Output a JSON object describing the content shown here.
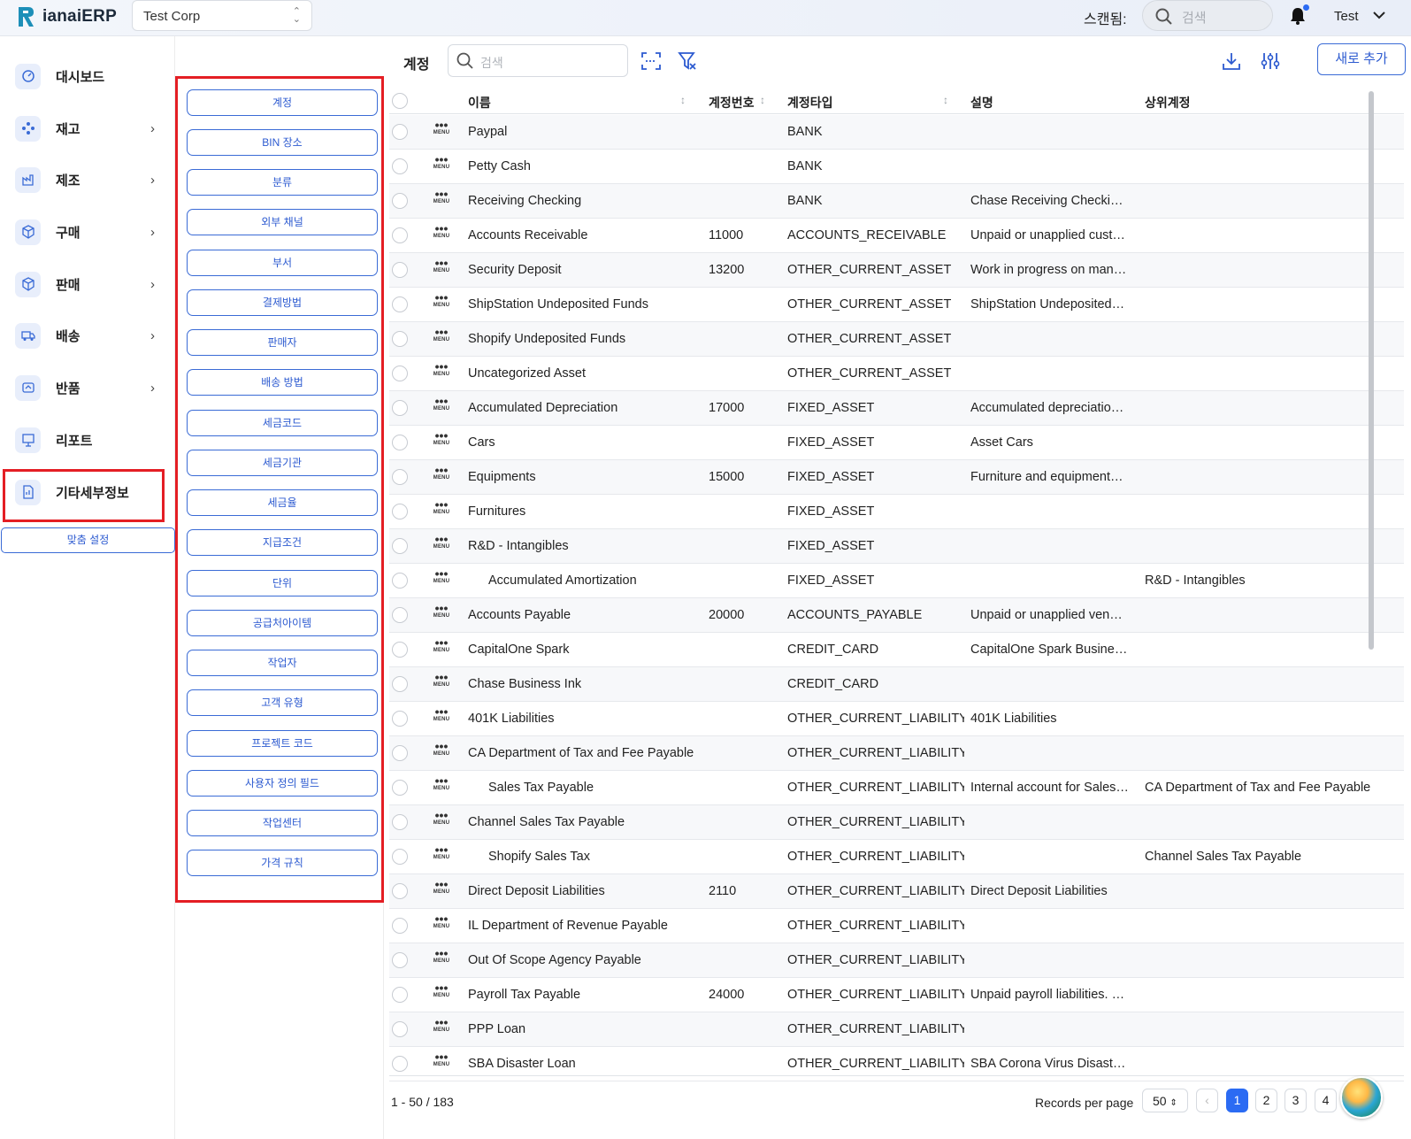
{
  "app": {
    "name": "ianaiERP",
    "company": "Test Corp",
    "scan_label": "스캔됨:",
    "search_placeholder": "검색",
    "user": "Test"
  },
  "sidebar": {
    "items": [
      {
        "label": "대시보드",
        "icon": "dashboard-icon",
        "chevron": false
      },
      {
        "label": "재고",
        "icon": "inventory-icon",
        "chevron": true
      },
      {
        "label": "제조",
        "icon": "manufacturing-icon",
        "chevron": true
      },
      {
        "label": "구매",
        "icon": "purchase-icon",
        "chevron": true
      },
      {
        "label": "판매",
        "icon": "sales-icon",
        "chevron": true
      },
      {
        "label": "배송",
        "icon": "shipping-icon",
        "chevron": true
      },
      {
        "label": "반품",
        "icon": "returns-icon",
        "chevron": true
      },
      {
        "label": "리포트",
        "icon": "report-icon",
        "chevron": false
      },
      {
        "label": "기타세부정보",
        "icon": "details-icon",
        "chevron": false
      }
    ],
    "custom_settings": "맞춤 설정"
  },
  "submenu": {
    "items": [
      "계정",
      "BIN 장소",
      "분류",
      "외부 채널",
      "부서",
      "결제방법",
      "판매자",
      "배송 방법",
      "세금코드",
      "세금기관",
      "세금율",
      "지급조건",
      "단위",
      "공급처아이템",
      "작업자",
      "고객 유형",
      "프로젝트 코드",
      "사용자 정의 필드",
      "작업센터",
      "가격 규칙"
    ]
  },
  "main": {
    "title": "계정",
    "search_placeholder": "검색",
    "add_button": "새로 추가",
    "columns": {
      "name": "이름",
      "number": "계정번호",
      "type": "계정타입",
      "description": "설명",
      "parent": "상위계정"
    },
    "menu_label": "MENU",
    "rows": [
      {
        "name": "Paypal",
        "number": "",
        "type": "BANK",
        "description": "",
        "parent": "",
        "indent": false
      },
      {
        "name": "Petty Cash",
        "number": "",
        "type": "BANK",
        "description": "",
        "parent": "",
        "indent": false
      },
      {
        "name": "Receiving Checking",
        "number": "",
        "type": "BANK",
        "description": "Chase Receiving Checkin…",
        "parent": "",
        "indent": false
      },
      {
        "name": "Accounts Receivable",
        "number": "11000",
        "type": "ACCOUNTS_RECEIVABLE",
        "description": "Unpaid or unapplied cust…",
        "parent": "",
        "indent": false
      },
      {
        "name": "Security Deposit",
        "number": "13200",
        "type": "OTHER_CURRENT_ASSET",
        "description": "Work in progress on man…",
        "parent": "",
        "indent": false
      },
      {
        "name": "ShipStation Undeposited Funds",
        "number": "",
        "type": "OTHER_CURRENT_ASSET",
        "description": "ShipStation Undeposited…",
        "parent": "",
        "indent": false
      },
      {
        "name": "Shopify Undeposited Funds",
        "number": "",
        "type": "OTHER_CURRENT_ASSET",
        "description": "",
        "parent": "",
        "indent": false
      },
      {
        "name": "Uncategorized Asset",
        "number": "",
        "type": "OTHER_CURRENT_ASSET",
        "description": "",
        "parent": "",
        "indent": false
      },
      {
        "name": "Accumulated Depreciation",
        "number": "17000",
        "type": "FIXED_ASSET",
        "description": "Accumulated depreciatio…",
        "parent": "",
        "indent": false
      },
      {
        "name": "Cars",
        "number": "",
        "type": "FIXED_ASSET",
        "description": "Asset Cars",
        "parent": "",
        "indent": false
      },
      {
        "name": "Equipments",
        "number": "15000",
        "type": "FIXED_ASSET",
        "description": "Furniture and equipment…",
        "parent": "",
        "indent": false
      },
      {
        "name": "Furnitures",
        "number": "",
        "type": "FIXED_ASSET",
        "description": "",
        "parent": "",
        "indent": false
      },
      {
        "name": "R&D - Intangibles",
        "number": "",
        "type": "FIXED_ASSET",
        "description": "",
        "parent": "",
        "indent": false
      },
      {
        "name": "Accumulated Amortization",
        "number": "",
        "type": "FIXED_ASSET",
        "description": "",
        "parent": "R&D - Intangibles",
        "indent": true
      },
      {
        "name": "Accounts Payable",
        "number": "20000",
        "type": "ACCOUNTS_PAYABLE",
        "description": "Unpaid or unapplied ven…",
        "parent": "",
        "indent": false
      },
      {
        "name": "CapitalOne Spark",
        "number": "",
        "type": "CREDIT_CARD",
        "description": "CapitalOne Spark Busine…",
        "parent": "",
        "indent": false
      },
      {
        "name": "Chase Business Ink",
        "number": "",
        "type": "CREDIT_CARD",
        "description": "",
        "parent": "",
        "indent": false
      },
      {
        "name": "401K Liabilities",
        "number": "",
        "type": "OTHER_CURRENT_LIABILITY",
        "description": "401K Liabilities",
        "parent": "",
        "indent": false
      },
      {
        "name": "CA Department of Tax and Fee Payable",
        "number": "",
        "type": "OTHER_CURRENT_LIABILITY",
        "description": "",
        "parent": "",
        "indent": false
      },
      {
        "name": "Sales Tax Payable",
        "number": "",
        "type": "OTHER_CURRENT_LIABILITY",
        "description": "Internal account for Sales…",
        "parent": "CA Department of Tax and Fee Payable",
        "indent": true
      },
      {
        "name": "Channel Sales Tax Payable",
        "number": "",
        "type": "OTHER_CURRENT_LIABILITY",
        "description": "",
        "parent": "",
        "indent": false
      },
      {
        "name": "Shopify Sales Tax",
        "number": "",
        "type": "OTHER_CURRENT_LIABILITY",
        "description": "",
        "parent": "Channel Sales Tax Payable",
        "indent": true
      },
      {
        "name": "Direct Deposit Liabilities",
        "number": "2110",
        "type": "OTHER_CURRENT_LIABILITY",
        "description": "Direct Deposit Liabilities",
        "parent": "",
        "indent": false
      },
      {
        "name": "IL Department of Revenue Payable",
        "number": "",
        "type": "OTHER_CURRENT_LIABILITY",
        "description": "",
        "parent": "",
        "indent": false
      },
      {
        "name": "Out Of Scope Agency Payable",
        "number": "",
        "type": "OTHER_CURRENT_LIABILITY",
        "description": "",
        "parent": "",
        "indent": false
      },
      {
        "name": "Payroll Tax Payable",
        "number": "24000",
        "type": "OTHER_CURRENT_LIABILITY",
        "description": "Unpaid payroll liabilities. …",
        "parent": "",
        "indent": false
      },
      {
        "name": "PPP Loan",
        "number": "",
        "type": "OTHER_CURRENT_LIABILITY",
        "description": "",
        "parent": "",
        "indent": false
      },
      {
        "name": "SBA Disaster Loan",
        "number": "",
        "type": "OTHER_CURRENT_LIABILITY",
        "description": "SBA Corona Virus Disaste…",
        "parent": "",
        "indent": false
      }
    ],
    "footer": {
      "records": "1 - 50 / 183",
      "records_per_page_label": "Records per page",
      "records_per_page": "50",
      "pages": [
        "1",
        "2",
        "3",
        "4"
      ],
      "current_page": "1"
    }
  },
  "colors": {
    "accent": "#2b6bf3",
    "highlight": "#e41e24",
    "link_blue": "#2c5ad0"
  }
}
